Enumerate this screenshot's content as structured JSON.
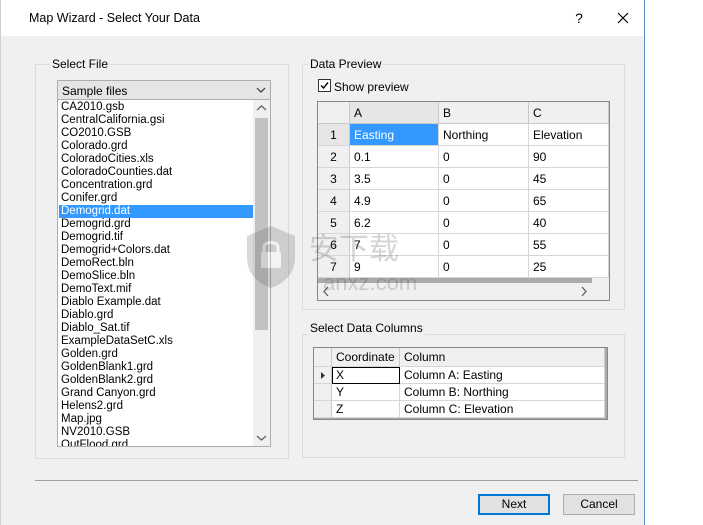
{
  "window": {
    "title": "Map Wizard - Select Your Data",
    "help_label": "?"
  },
  "select_file": {
    "group_label": "Select File",
    "combo_value": "Sample files",
    "selected_file": "Demogrid.dat",
    "files": [
      "CA2010.gsb",
      "CentralCalifornia.gsi",
      "CO2010.GSB",
      "Colorado.grd",
      "ColoradoCities.xls",
      "ColoradoCounties.dat",
      "Concentration.grd",
      "Conifer.grd",
      "Demogrid.dat",
      "Demogrid.grd",
      "Demogrid.tif",
      "Demogrid+Colors.dat",
      "DemoRect.bln",
      "DemoSlice.bln",
      "DemoText.mif",
      "Diablo Example.dat",
      "Diablo.grd",
      "Diablo_Sat.tif",
      "ExampleDataSetC.xls",
      "Golden.grd",
      "GoldenBlank1.grd",
      "GoldenBlank2.grd",
      "Grand Canyon.grd",
      "Helens2.grd",
      "Map.jpg",
      "NV2010.GSB",
      "OutFlood.grd"
    ]
  },
  "data_preview": {
    "group_label": "Data Preview",
    "show_preview_label": "Show preview",
    "show_preview_checked": true,
    "columns": [
      "A",
      "B",
      "C"
    ],
    "rows": [
      {
        "num": "1",
        "cells": [
          "Easting",
          "Northing",
          "Elevation"
        ]
      },
      {
        "num": "2",
        "cells": [
          "0.1",
          "0",
          "90"
        ]
      },
      {
        "num": "3",
        "cells": [
          "3.5",
          "0",
          "45"
        ]
      },
      {
        "num": "4",
        "cells": [
          "4.9",
          "0",
          "65"
        ]
      },
      {
        "num": "5",
        "cells": [
          "6.2",
          "0",
          "40"
        ]
      },
      {
        "num": "6",
        "cells": [
          "7",
          "0",
          "55"
        ]
      },
      {
        "num": "7",
        "cells": [
          "9",
          "0",
          "25"
        ]
      }
    ]
  },
  "select_columns": {
    "group_label": "Select Data Columns",
    "headers": [
      "Coordinate",
      "Column"
    ],
    "rows": [
      {
        "coord": "X",
        "column": "Column A:  Easting"
      },
      {
        "coord": "Y",
        "column": "Column B:  Northing"
      },
      {
        "coord": "Z",
        "column": "Column C:  Elevation"
      }
    ]
  },
  "buttons": {
    "next_label": "Next",
    "cancel_label": "Cancel"
  },
  "watermark": {
    "text_cn": "安下载",
    "text_en": "anxz.com"
  },
  "colors": {
    "selection": "#3399ff",
    "dialog_bg": "#f0f0f0",
    "default_button_border": "#0078d7"
  }
}
